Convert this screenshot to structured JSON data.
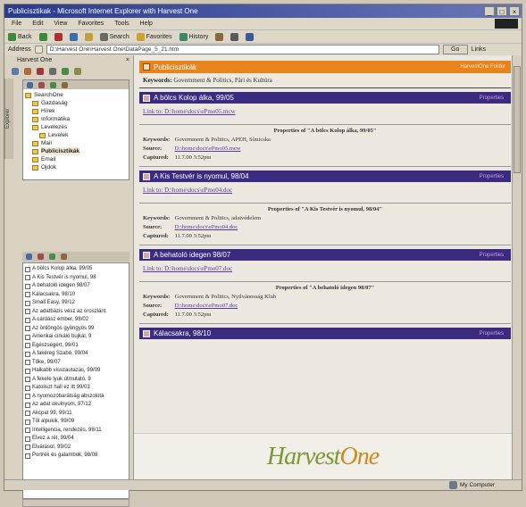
{
  "window": {
    "title": "Publicisztikak - Microsoft Internet Explorer with Harvest One",
    "controls": [
      "_",
      "□",
      "×"
    ]
  },
  "menubar": [
    "File",
    "Edit",
    "View",
    "Favorites",
    "Tools",
    "Help"
  ],
  "toolbar": {
    "back": "Back",
    "search": "Search",
    "favorites": "Favorites",
    "history": "History"
  },
  "addressbar": {
    "label": "Address",
    "url": "D:\\Harvest One\\Harvest One\\DataPage_5_21.htm",
    "go": "Go",
    "links": "Links"
  },
  "leftpane": {
    "header": "Harvest One",
    "vtab": "Explorer",
    "tree": [
      {
        "label": "SearchOne",
        "level": 0,
        "selected": false
      },
      {
        "label": "Gazdaság",
        "level": 1,
        "selected": false
      },
      {
        "label": "Hírek",
        "level": 1,
        "selected": false
      },
      {
        "label": "Informatika",
        "level": 1,
        "selected": false
      },
      {
        "label": "Levelezés",
        "level": 1,
        "selected": false
      },
      {
        "label": "Levelek",
        "level": 2,
        "selected": false
      },
      {
        "label": "Mail",
        "level": 1,
        "selected": false
      },
      {
        "label": "Publicisztikák",
        "level": 1,
        "selected": true
      },
      {
        "label": "Email",
        "level": 1,
        "selected": false
      },
      {
        "label": "Ojdok",
        "level": 1,
        "selected": false
      }
    ],
    "list": [
      "A bölcs Kolop álka, 99/05",
      "A Kis Testvér is nyomul, 98",
      "A behatoló idegen 98/07",
      "Kálacsakra, 98/10",
      "Small Easy, 99/12",
      "Az adatbázis vész az oroszlánt",
      "A cárdász ember, 98/02",
      "Az ördöngös gyöngyös 99",
      "Amerikai cirkáló bujkál, 9",
      "Egészségért, 99/01",
      "A fakéreg Szabó, 99/04",
      "Tőke, 99/07",
      "Halkabb visszautazás, 99/09",
      "A fekete lyuk útmutató, 9",
      "Katoliszt hall ez itt 99/03",
      "A nyomozóbarátság abszolútá",
      "Az adat okulnyom, 97/12",
      "Akcpat 99, 99/11",
      "Tól alpukik, 99/09",
      "Intelligencia, rendezés, 98/11",
      "Élvez a rét, 99/04",
      "Elvárásol, 99/02",
      "Portrék és galambok, 98/08"
    ]
  },
  "content": {
    "folder": {
      "title": "Publicisztikák",
      "right": "HarvestOne Folder",
      "keywords_label": "Keywords:",
      "keywords": "Government & Politics, Pári és Kultúra"
    },
    "docs": [
      {
        "title": "A bölcs Kolop álka, 99/05",
        "right_link": "Properties",
        "link": "Link to: D:\\home\\docs\\ePmo05.mcw",
        "props_title": "Properties of \"A bölcs Kolop álka, 99/05\"",
        "kw_label": "Keywords:",
        "keywords": "Government & Politics, APEH, Símicska",
        "source_label": "Source:",
        "source": "D:\\home\\docs\\ePmo05.mcw",
        "captured_label": "Captured:",
        "captured": "11.7.00 3:52pm"
      },
      {
        "title": "A Kis Testvér is nyomul, 98/04",
        "right_link": "Properties",
        "link": "Link to: D:\\home\\docs\\ePmo04.doc",
        "props_title": "Properties of \"A Kis Testvér is nyomul, 98/04\"",
        "kw_label": "Keywords:",
        "keywords": "Government & Politics, adatvédelem",
        "source_label": "Source:",
        "source": "D:\\home\\docs\\ePmo04.doc",
        "captured_label": "Captured:",
        "captured": "11.7.00 3:52pm"
      },
      {
        "title": "A behatoló idegen 98/07",
        "right_link": "Properties",
        "link": "Link to: D:\\home\\docs\\ePmo07.doc",
        "props_title": "Properties of \"A behatoló idegen 98/07\"",
        "kw_label": "Keywords:",
        "keywords": "Government & Politics, Nyilvánosság Klub",
        "source_label": "Source:",
        "source": "D:\\home\\docs\\ePmo07.doc",
        "captured_label": "Captured:",
        "captured": "11.7.00 3:52pm"
      },
      {
        "title": "Kálacsakra, 98/10",
        "right_link": "Properties"
      }
    ],
    "logo_harvest": "Harvest",
    "logo_one": "One"
  },
  "statusbar": {
    "zone": "My Computer"
  },
  "colors": {
    "folder_bar": "#e8841e",
    "doc_bar": "#3a2a80",
    "link": "#5a3aa0"
  }
}
